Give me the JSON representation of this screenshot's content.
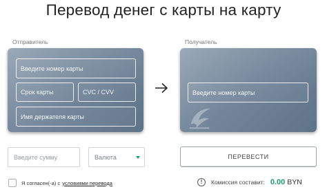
{
  "header": {
    "title": "Перевод денег с карты на карту"
  },
  "sender": {
    "label": "Отправитель",
    "card_number_placeholder": "Введите номер карты",
    "expiry_placeholder": "Срок карты",
    "cvc_placeholder": "CVC / CVV",
    "holder_placeholder": "Имя держателя карты"
  },
  "recipient": {
    "label": "Получатель",
    "card_number_placeholder": "Введите номер карты"
  },
  "transfer_arrow_icon": "arrow-right-icon",
  "amount": {
    "placeholder": "Введите сумму"
  },
  "currency": {
    "selected": "Валюта",
    "caret_icon": "chevron-down-icon"
  },
  "actions": {
    "transfer_label": "ПЕРЕВЕСТИ"
  },
  "agreement": {
    "text": "Я согласен(-а) с",
    "link_text": "условиями перевода"
  },
  "commission": {
    "info_icon": "info-icon",
    "info_symbol": "!",
    "label": "Комиссия составит:",
    "value": "0.00",
    "currency": "BYN"
  },
  "colors": {
    "accent_green": "#1a9e6a",
    "card_gradient_start": "#8f9fb0",
    "card_gradient_end": "#5f7388"
  }
}
